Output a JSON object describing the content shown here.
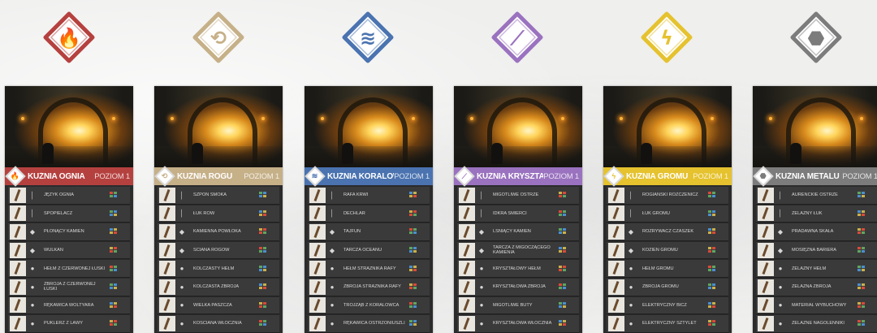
{
  "colors": {
    "fire": "#b5413f",
    "horn": "#c6b088",
    "coral": "#4a73b0",
    "crystal": "#9a72bf",
    "thunder": "#e5c22e",
    "metal": "#7c7c7c"
  },
  "emblems": [
    {
      "icon": "fire-emblem-icon",
      "color": "#b5413f",
      "glyph": "🔥"
    },
    {
      "icon": "horn-emblem-icon",
      "color": "#c6b088",
      "glyph": "⟲"
    },
    {
      "icon": "coral-emblem-icon",
      "color": "#4a73b0",
      "glyph": "≋"
    },
    {
      "icon": "crystal-emblem-icon",
      "color": "#9a72bf",
      "glyph": "⟋"
    },
    {
      "icon": "thunder-emblem-icon",
      "color": "#e5c22e",
      "glyph": "ϟ"
    },
    {
      "icon": "metal-emblem-icon",
      "color": "#7c7c7c",
      "glyph": "⬣"
    }
  ],
  "cards": [
    {
      "title": "KUŹNIA OGNIA",
      "level": "POZIOM 1",
      "color": "#b5413f",
      "text_color": "#ffffff",
      "items": [
        "JĘZYK OGNIA",
        "SPOPIELACZ",
        "PŁONĄCY KAMIEŃ",
        "WULKAN",
        "HEŁM Z CZERWONEJ ŁUSKI",
        "ZBROJA Z CZERWONEJ ŁUSKI",
        "RĘKAWICA WOLTYARA",
        "PUKLERZ Z LAWY"
      ]
    },
    {
      "title": "KUŹNIA ROGU",
      "level": "POZIOM 1",
      "color": "#c6b088",
      "text_color": "#ffffff",
      "items": [
        "SZPON SMOKA",
        "ŁUK RÓW",
        "KAMIENNA POWŁOKA",
        "ŚCIANA ROGÓW",
        "KOLCZASTY HEŁM",
        "KOLCZASTA ZBROJA",
        "WIELKA PASZCZA",
        "KOŚCIANA WŁÓCZNIA"
      ]
    },
    {
      "title": "KUŹNIA KORALOWCA",
      "level": "POZIOM 1",
      "color": "#4a73b0",
      "text_color": "#ffffff",
      "items": [
        "RAFA KRWI",
        "DECHLAR",
        "TAJFUN",
        "TARCZA OCEANU",
        "HEŁM STRAŻNIKA RAFY",
        "ZBROJA STRAŻNIKA RAFY",
        "TRÓJZĄB Z KORALOWCA",
        "RĘKAWICA OSTRZONIUSZLI"
      ]
    },
    {
      "title": "KUŹNIA KRYSZTAŁU",
      "level": "POZIOM 1",
      "color": "#9a72bf",
      "text_color": "#ffffff",
      "items": [
        "MIGOTLIWE OSTRZE",
        "IDKRA ŚMIERCI",
        "LŚNIĄCY KAMIEŃ",
        "TARCZA Z MIGOCZĄCEGO KAMIENIA",
        "KRYSZTAŁOWY HEŁM",
        "KRYSZTAŁOWA ZBROJA",
        "MIGOTLIWE BUTY",
        "KRYSZTAŁOWA WŁÓCZNIA"
      ]
    },
    {
      "title": "KUŹNIA GROMU",
      "level": "POZIOM 1",
      "color": "#e5c22e",
      "text_color": "#ffffff",
      "items": [
        "ROGIANSKI ROZCZENICZ",
        "ŁUK GROMU",
        "ROZRYWACZ CZASZEK",
        "KOZIEN GROMU",
        "HEŁM GROMU",
        "ZBROJA GROMU",
        "ELEKTRYCZNY BICZ",
        "ELEKTRYCZNY SZTYLET"
      ]
    },
    {
      "title": "KUŹNIA METALU",
      "level": "POZIOM 1",
      "color": "#7c7c7c",
      "text_color": "#ffffff",
      "items": [
        "AURENCKIE OSTRZE",
        "ŻELAZNY ŁUK",
        "PRADAWNA SKAŁA",
        "MOSIĘŻNA BARIERA",
        "ŻELAZNY HEŁM",
        "ŻELAZNA ZBROJA",
        "MATERIAŁ WYBUCHOWY",
        "ŻELAZNE NAGOLENNIKI"
      ]
    }
  ]
}
